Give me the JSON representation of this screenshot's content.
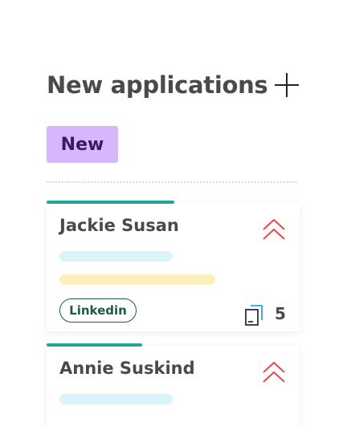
{
  "header": {
    "title": "New applications",
    "add_icon": "plus-icon"
  },
  "column": {
    "tag_label": "New",
    "tag_color": "#d7b7fb"
  },
  "cards": [
    {
      "name": "Jackie Susan",
      "priority_icon": "double-chevron-up-icon",
      "priority_color": "#e8474c",
      "source": "Linkedin",
      "documents_icon": "documents-icon",
      "documents_count": "5",
      "accent_color": "#22a597"
    },
    {
      "name": "Annie Suskind",
      "priority_icon": "double-chevron-up-icon",
      "priority_color": "#e8474c",
      "accent_color": "#22a597"
    }
  ]
}
